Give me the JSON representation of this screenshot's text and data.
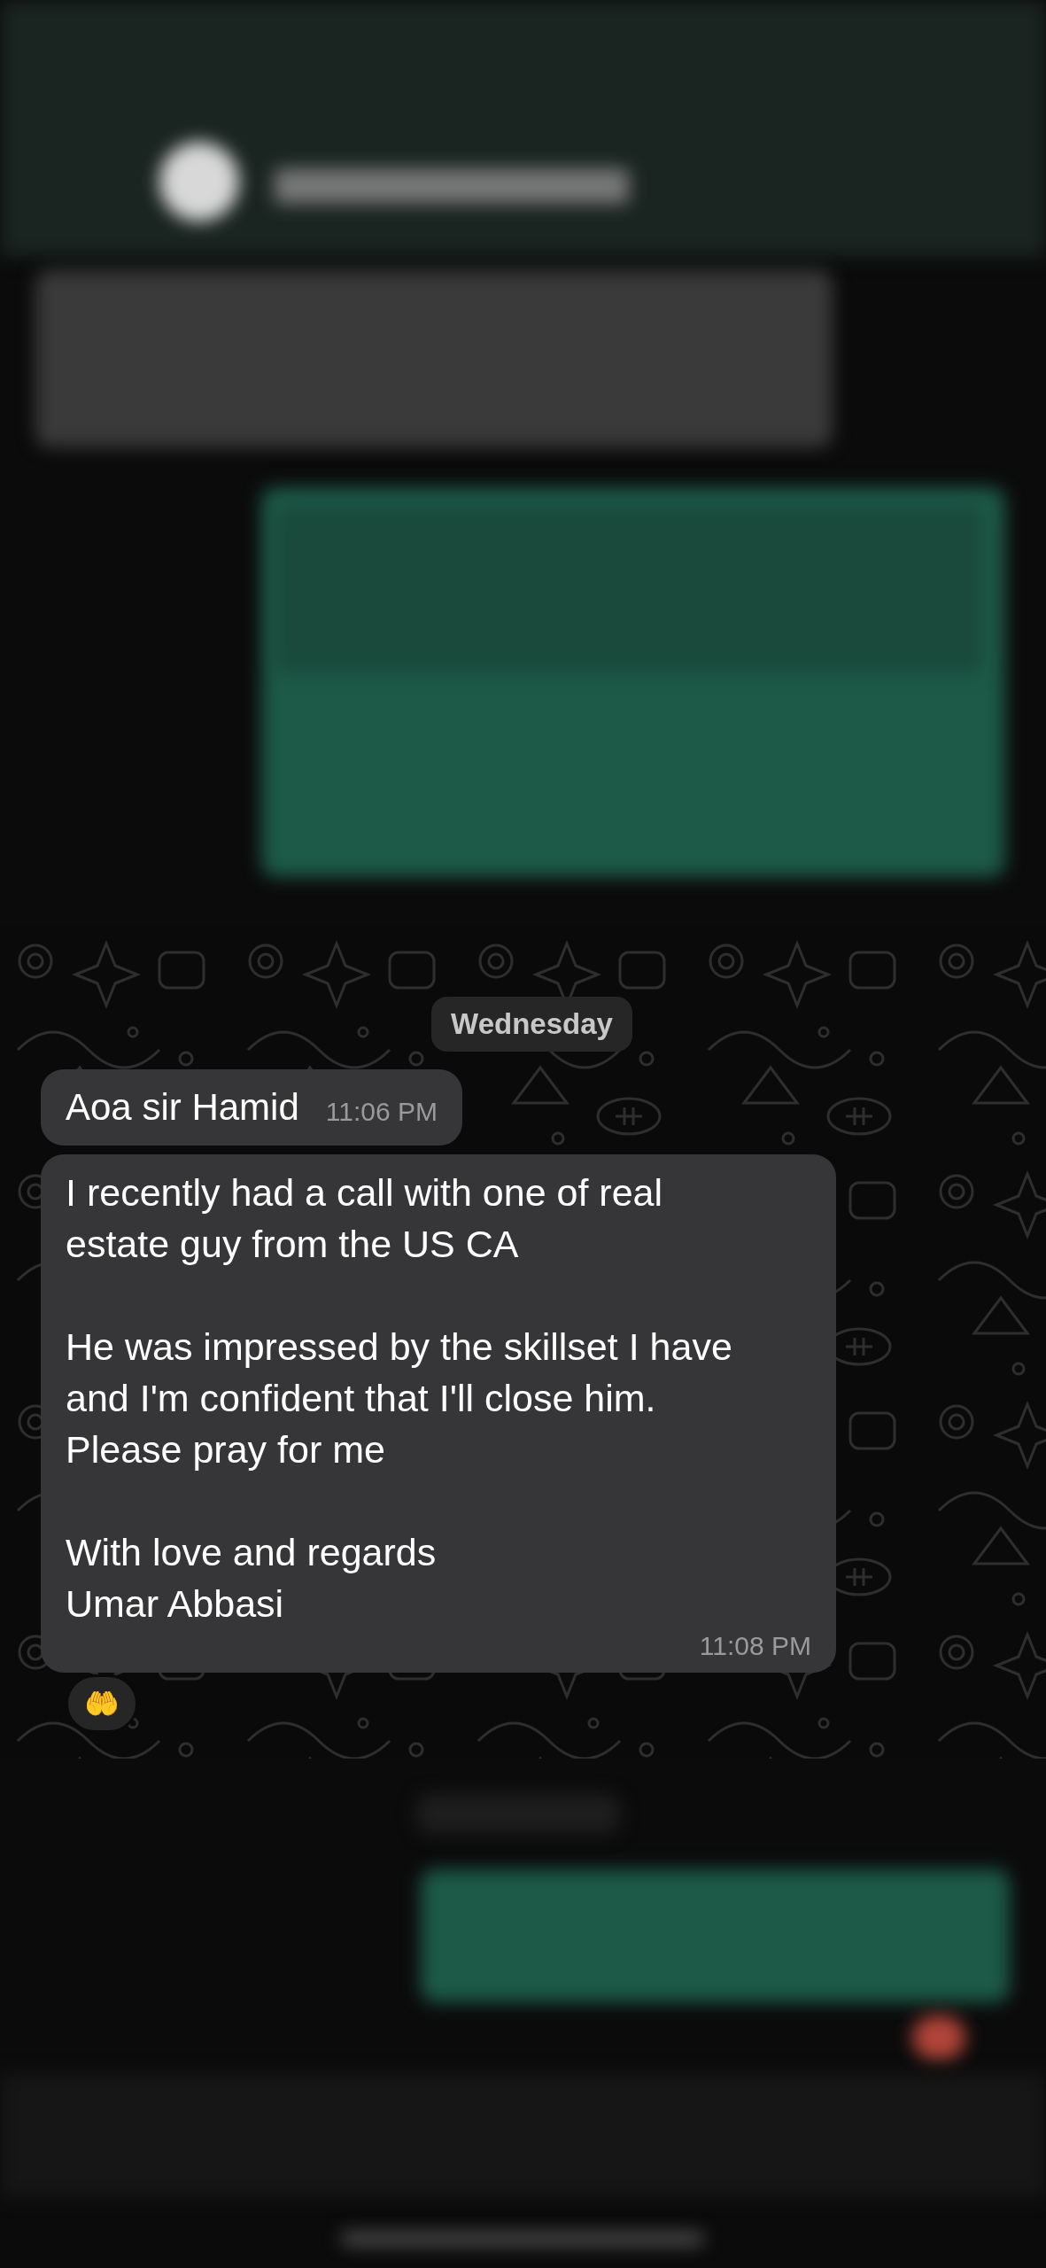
{
  "date_divider": "Wednesday",
  "messages": [
    {
      "text": "Aoa sir Hamid",
      "time": "11:06 PM"
    },
    {
      "text": "I recently had a call with one of real estate guy from the US CA\n\nHe was impressed by the skillset I have and I'm confident that I'll close him. Please pray for me\n\nWith love and regards\nUmar Abbasi",
      "time": "11:08 PM",
      "reaction": "🤲"
    }
  ]
}
